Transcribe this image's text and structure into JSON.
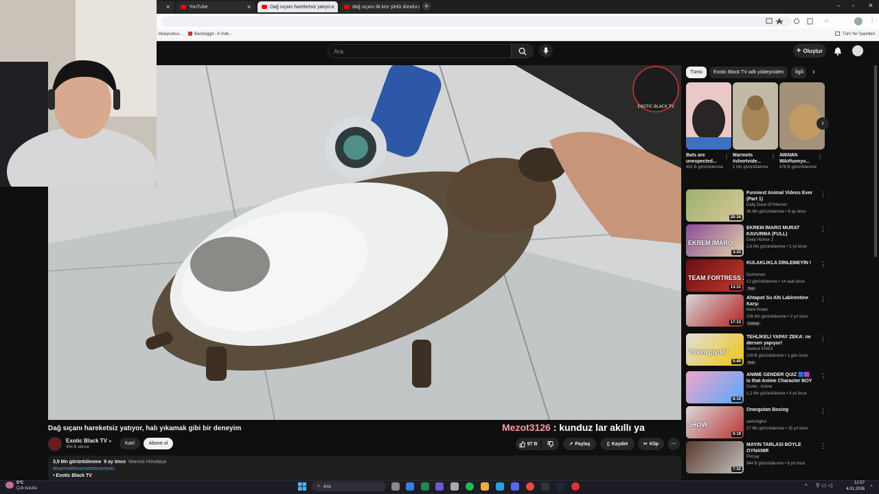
{
  "browser": {
    "tabs": [
      {
        "label": "YouTube"
      },
      {
        "label": "Dağ sıçanı hareketsiz yatıyo"
      },
      {
        "label": "dağ sıçanı ilk kez şleklı donduı"
      }
    ],
    "bookmarks": [
      "kbarysukus...",
      "Backloggd - A Vide...",
      "Tüm Yer İşaretleri"
    ]
  },
  "header": {
    "search_placeholder": "Ara",
    "create_label": "Oluştur"
  },
  "video": {
    "title": "Dağ sıçanı hareketsiz yatıyor, halı yıkamak gibi bir deneyim",
    "channel": "Exotic Black TV",
    "subscribers": "454 B abone",
    "join_label": "Katıl",
    "subscribe_label": "Abone ol",
    "likes": "97 B",
    "share_label": "Paylaş",
    "save_label": "Kaydet",
    "clip_label": "Klip",
    "views": "3,5 Mn görüntülenme",
    "age": "9 ay önce",
    "place": "Marmot Himalaya",
    "tags": "#marmot#marmots#marmots",
    "desc_channel": "Exotic Black TV",
    "watermark_text": "EXOTIC BLACK TV"
  },
  "chat_overlay": {
    "user": "Mezot3126",
    "message": " : kunduz lar akıllı ya"
  },
  "sidebar": {
    "chips": [
      "Tümü",
      "Exotic Black TV adlı yükleyiciden",
      "İlgili"
    ],
    "shorts": [
      {
        "title": "Bats are unexpected...",
        "views": "452 B görüntülenme"
      },
      {
        "title": "Marmots #shortvide...",
        "views": "1 Mn görüntülenme"
      },
      {
        "title": "AWAWA WA#funnyv...",
        "views": "678 B görüntülenme"
      }
    ],
    "recs": [
      {
        "title": "Funniest Animal Videos Ever (Part 1)",
        "channel": "Daily Dose Of Internet",
        "meta": "36 Mn görüntülenme • 8 ay önce",
        "duration": "20:34",
        "badge": "",
        "thumb_text": ""
      },
      {
        "title": "EKREM İMARO MURAT KAVURMA (FULL)",
        "channel": "Deep Humor 2",
        "meta": "2,6 Mn görüntülenme • 1 yıl önce",
        "duration": "3:33",
        "badge": "",
        "thumb_text": "EKREM İMARO"
      },
      {
        "title": "KULAKLIKLA DİNLEMEYİN !",
        "channel": "Demoman",
        "meta": "12 görüntülenme • 14 saat önce",
        "duration": "13:31",
        "badge": "Yeni",
        "thumb_text": "TEAM FORTRESS 2"
      },
      {
        "title": "Ahtapot Su Altı Labirentine Karşı",
        "channel": "Mark Rober",
        "meta": "109 Mn görüntülenme • 2 yıl önce",
        "duration": "17:13",
        "badge": "Dublajlı",
        "thumb_text": ""
      },
      {
        "title": "TEHLİKELİ YAPAY ZEKA: ne dersen yapıyor!",
        "channel": "Sadece ENES",
        "meta": "109 B görüntülenme • 1 gün önce",
        "duration": "5:40",
        "badge": "Yeni",
        "thumb_text": "\"bikini giydir\""
      },
      {
        "title": "ANIME GENDER QUIZ 🟦🟪 Is that Anime Character BOY or ...",
        "channel": "Donki - Anime",
        "meta": "1,2 Mn görüntülenme • 3 yıl önce",
        "duration": "8:10",
        "badge": "",
        "thumb_text": ""
      },
      {
        "title": "Orangutan Boxing",
        "channel": "samongkol",
        "meta": "27 Mn görüntülenme • 15 yıl önce",
        "duration": "9:19",
        "badge": "",
        "thumb_text": "SHOW"
      },
      {
        "title": "MAYIN TARLASI BÖYLE OYNANIR",
        "channel": "Porçay",
        "meta": "944 B görüntülenme • 6 yıl önce",
        "duration": "7:32",
        "badge": "",
        "thumb_text": ""
      }
    ]
  },
  "taskbar": {
    "weather_temp": "5°C",
    "weather_desc": "Çok bulutlu",
    "search_label": "Ara",
    "time": "12:57",
    "date": "4.01.2026"
  },
  "colors": {
    "youtube_red": "#ff0000",
    "link_blue": "#3ea6ff",
    "chat_user": "#ff9aa8"
  }
}
